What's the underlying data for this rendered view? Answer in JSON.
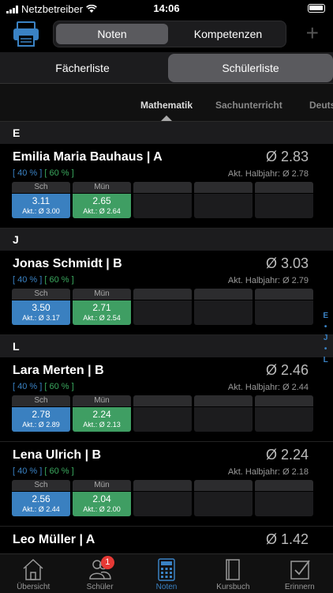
{
  "status": {
    "carrier": "Netzbetreiber",
    "time": "14:06"
  },
  "top": {
    "seg_active": "Noten",
    "seg_inactive": "Kompetenzen"
  },
  "list_tabs": {
    "a": "Fächerliste",
    "b": "Schülerliste"
  },
  "subjects": [
    "Mathematik",
    "Sachunterricht",
    "Deuts"
  ],
  "sections": [
    {
      "letter": "E",
      "students": [
        {
          "name": "Emilia Maria Bauhaus | A",
          "avg": "Ø 2.83",
          "w1": "[ 40 % ]",
          "w2": "[ 60 % ]",
          "half": "Akt. Halbjahr: Ø 2.78",
          "c1": {
            "h": "Sch",
            "v": "3.11",
            "s": "Akt.: Ø 3.00"
          },
          "c2": {
            "h": "Mün",
            "v": "2.65",
            "s": "Akt.: Ø 2.64"
          }
        }
      ]
    },
    {
      "letter": "J",
      "students": [
        {
          "name": "Jonas Schmidt | B",
          "avg": "Ø 3.03",
          "w1": "[ 40 % ]",
          "w2": "[ 60 % ]",
          "half": "Akt. Halbjahr: Ø 2.79",
          "c1": {
            "h": "Sch",
            "v": "3.50",
            "s": "Akt.: Ø 3.17"
          },
          "c2": {
            "h": "Mün",
            "v": "2.71",
            "s": "Akt.: Ø 2.54"
          }
        }
      ]
    },
    {
      "letter": "L",
      "students": [
        {
          "name": "Lara Merten | B",
          "avg": "Ø 2.46",
          "w1": "[ 40 % ]",
          "w2": "[ 60 % ]",
          "half": "Akt. Halbjahr: Ø 2.44",
          "c1": {
            "h": "Sch",
            "v": "2.78",
            "s": "Akt.: Ø 2.89"
          },
          "c2": {
            "h": "Mün",
            "v": "2.24",
            "s": "Akt.: Ø 2.13"
          }
        },
        {
          "name": "Lena Ulrich | B",
          "avg": "Ø 2.24",
          "w1": "[ 40 % ]",
          "w2": "[ 60 % ]",
          "half": "Akt. Halbjahr: Ø 2.18",
          "c1": {
            "h": "Sch",
            "v": "2.56",
            "s": "Akt.: Ø 2.44"
          },
          "c2": {
            "h": "Mün",
            "v": "2.04",
            "s": "Akt.: Ø 2.00"
          }
        },
        {
          "name": "Leo Müller | A",
          "avg": "Ø 1.42"
        }
      ]
    }
  ],
  "index": [
    "E",
    "•",
    "J",
    "•",
    "L"
  ],
  "tabs": [
    {
      "label": "Übersicht",
      "icon": "house-icon"
    },
    {
      "label": "Schüler",
      "icon": "people-icon",
      "badge": "1"
    },
    {
      "label": "Noten",
      "icon": "calculator-icon"
    },
    {
      "label": "Kursbuch",
      "icon": "book-icon"
    },
    {
      "label": "Erinnern",
      "icon": "checkbox-icon"
    }
  ],
  "colors": {
    "accent": "#3a82c4",
    "green": "#3f9e63",
    "badge": "#e53935"
  }
}
